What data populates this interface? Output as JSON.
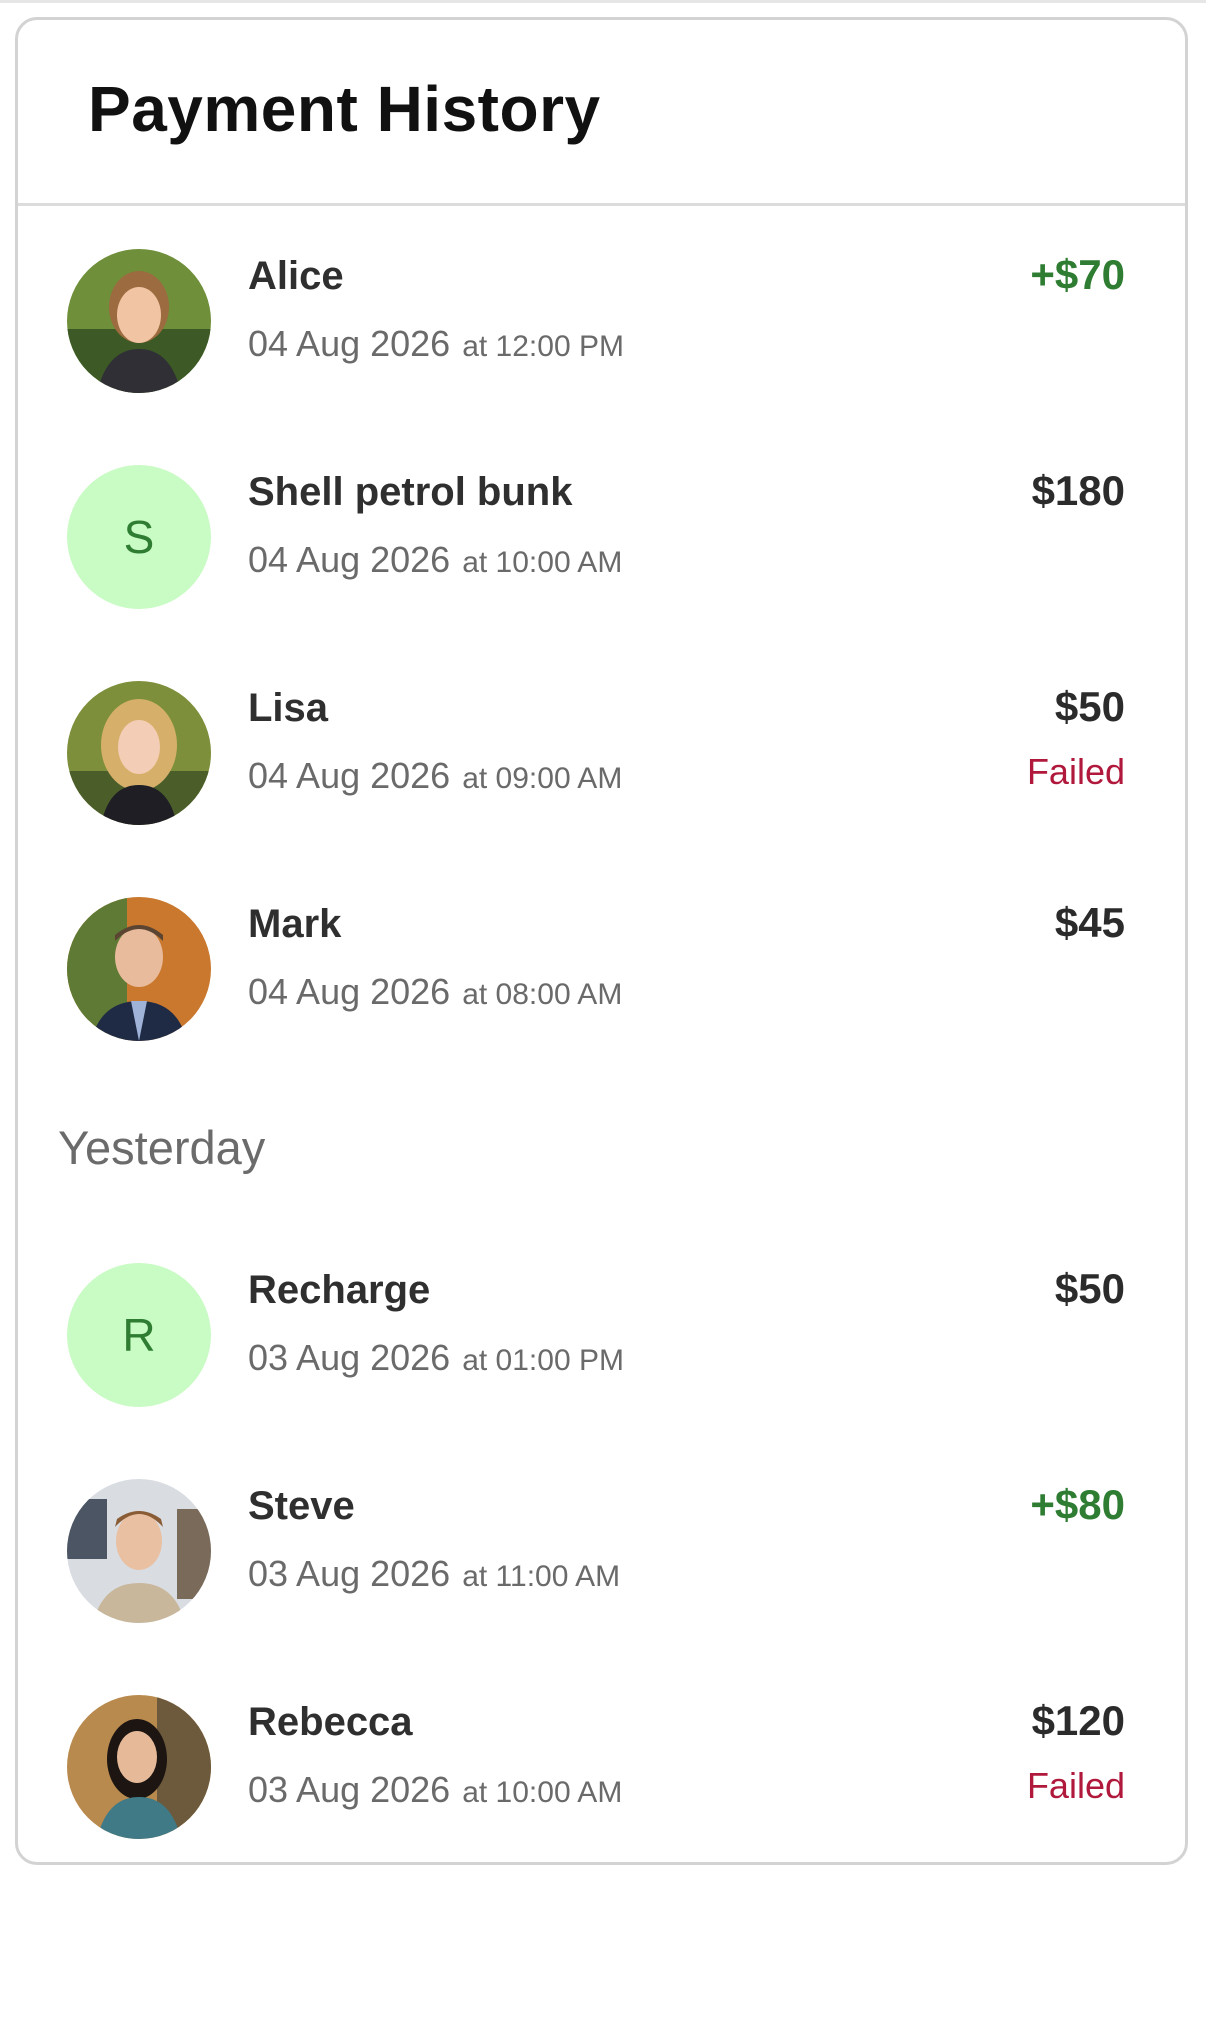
{
  "header": {
    "title": "Payment History"
  },
  "sections": [
    {
      "label": "",
      "items": [
        {
          "name": "Alice",
          "date": "04 Aug 2026",
          "time": "at 12:00 PM",
          "amount": "+$70",
          "status": "",
          "credit": true,
          "avatar": "photo"
        },
        {
          "name": "Shell petrol bunk",
          "date": "04 Aug 2026",
          "time": "at 10:00 AM",
          "amount": "$180",
          "status": "",
          "credit": false,
          "avatar": "S"
        },
        {
          "name": "Lisa",
          "date": "04 Aug 2026",
          "time": "at 09:00 AM",
          "amount": "$50",
          "status": "Failed",
          "credit": false,
          "avatar": "photo"
        },
        {
          "name": "Mark",
          "date": "04 Aug 2026",
          "time": "at 08:00 AM",
          "amount": "$45",
          "status": "",
          "credit": false,
          "avatar": "photo"
        }
      ]
    },
    {
      "label": "Yesterday",
      "items": [
        {
          "name": "Recharge",
          "date": "03 Aug 2026",
          "time": "at 01:00 PM",
          "amount": "$50",
          "status": "",
          "credit": false,
          "avatar": "R"
        },
        {
          "name": "Steve",
          "date": "03 Aug 2026",
          "time": "at 11:00 AM",
          "amount": "+$80",
          "status": "",
          "credit": true,
          "avatar": "photo"
        },
        {
          "name": "Rebecca",
          "date": "03 Aug 2026",
          "time": "at 10:00 AM",
          "amount": "$120",
          "status": "Failed",
          "credit": false,
          "avatar": "photo"
        }
      ]
    }
  ],
  "colors": {
    "credit": "#2e7d32",
    "failed": "#b0183c",
    "letter_avatar_bg": "#c9fbc4",
    "border": "#d3d3d3"
  }
}
